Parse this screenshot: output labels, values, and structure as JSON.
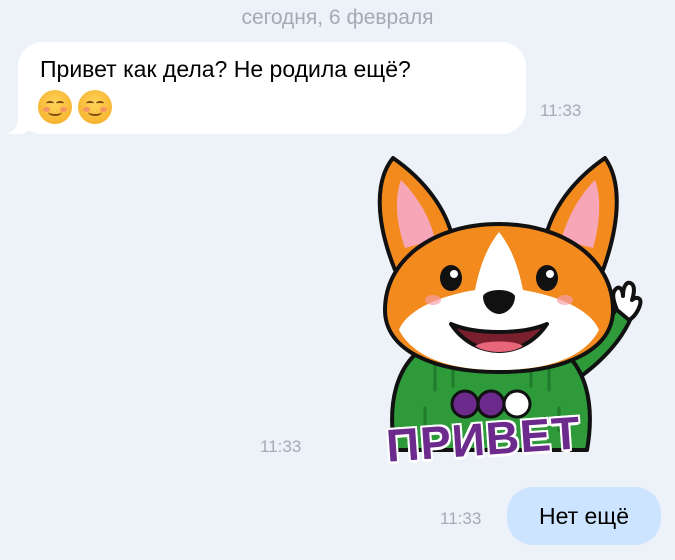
{
  "date_separator": "сегодня, 6 февраля",
  "messages": [
    {
      "direction": "incoming",
      "text": "Привет как дела? Не родила ещё?",
      "emojis": [
        "smiling-face-icon",
        "smiling-face-icon"
      ],
      "time": "11:33"
    },
    {
      "direction": "incoming",
      "type": "sticker",
      "sticker_caption": "ПРИВЕТ",
      "sticker_icon": "corgi-waving-sticker",
      "time": "11:33"
    },
    {
      "direction": "outgoing",
      "text": "Нет ещё",
      "time": "11:33"
    }
  ],
  "colors": {
    "background": "#edf1f8",
    "incoming_bubble": "#ffffff",
    "outgoing_bubble": "#cce4ff",
    "meta_text": "#a3abb6",
    "sticker_caption": "#6b2a8c",
    "sticker_sweater": "#2e9a3a",
    "corgi_orange": "#f28a1e"
  }
}
